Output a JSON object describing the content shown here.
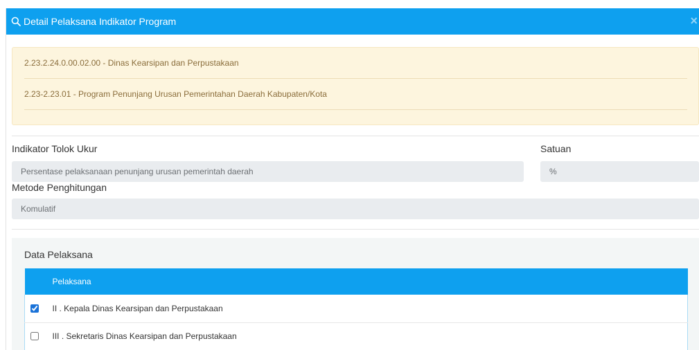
{
  "theme": {
    "primary": "#0ea0ef",
    "alert_bg": "#fdf5de",
    "alert_text": "#8a6d3b",
    "panel_bg": "#f3f6f6",
    "checkbox": "#1a72d8"
  },
  "modal": {
    "title": "Detail Pelaksana Indikator Program",
    "title_icon": "search-icon",
    "close_label": "×"
  },
  "info": {
    "unit": "2.23.2.24.0.00.02.00 - Dinas Kearsipan dan Perpustakaan",
    "program": "2.23-2.23.01 - Program Penunjang Urusan Pemerintahan Daerah Kabupaten/Kota"
  },
  "form": {
    "indikator": {
      "label": "Indikator Tolok Ukur",
      "value": "Persentase pelaksanaan penunjang urusan pemerintah daerah"
    },
    "satuan": {
      "label": "Satuan",
      "value": "%"
    },
    "metode": {
      "label": "Metode Penghitungan",
      "value": "Komulatif"
    }
  },
  "pelaksana": {
    "title": "Data Pelaksana",
    "column": "Pelaksana",
    "rows": [
      {
        "label": "II . Kepala Dinas Kearsipan dan Perpustakaan",
        "checked": true
      },
      {
        "label": "III . Sekretaris Dinas Kearsipan dan Perpustakaan",
        "checked": false
      }
    ]
  }
}
